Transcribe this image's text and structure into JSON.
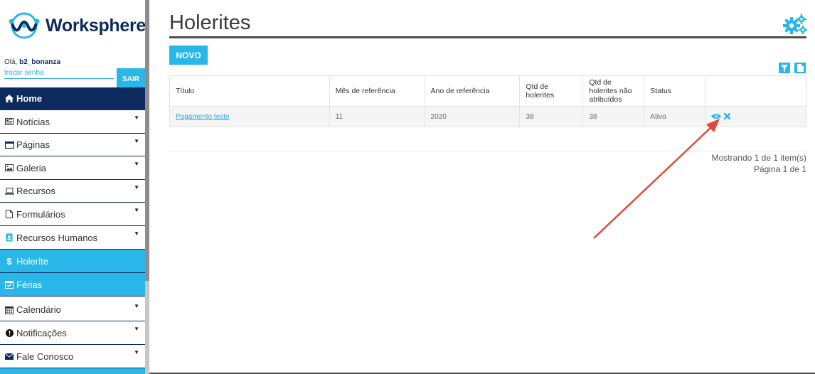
{
  "brand": {
    "name": "Worksphere"
  },
  "user": {
    "greeting": "Olá, ",
    "username": "b2_bonanza",
    "change_password": "trocar senha",
    "logout": "SAIR"
  },
  "sidebar": {
    "items": [
      {
        "label": "Home",
        "icon": "home-icon"
      },
      {
        "label": "Notícias",
        "icon": "newspaper-icon"
      },
      {
        "label": "Páginas",
        "icon": "window-icon"
      },
      {
        "label": "Galeria",
        "icon": "image-icon"
      },
      {
        "label": "Recursos",
        "icon": "laptop-icon"
      },
      {
        "label": "Formulários",
        "icon": "file-icon"
      },
      {
        "label": "Recursos Humanos",
        "icon": "id-badge-icon"
      },
      {
        "label": "Holerite",
        "icon": "dollar-icon"
      },
      {
        "label": "Férias",
        "icon": "calendar-check-icon"
      },
      {
        "label": "Calendário",
        "icon": "calendar-icon"
      },
      {
        "label": "Notificações",
        "icon": "exclamation-circle-icon"
      },
      {
        "label": "Fale Conosco",
        "icon": "envelope-icon"
      }
    ]
  },
  "page": {
    "title": "Holerites",
    "new_button": "NOVO"
  },
  "table": {
    "headers": [
      "Título",
      "Mês de referência",
      "Ano de referência",
      "Qtd de holerites",
      "Qtd de holerites não atribuídos",
      "Status",
      ""
    ],
    "rows": [
      {
        "titulo": "Pagamento teste",
        "mes": "11",
        "ano": "2020",
        "qtd": "38",
        "nao_atribuidos": "38",
        "status": "Ativo"
      }
    ]
  },
  "pager": {
    "showing": "Mostrando 1 de 1 item(s)",
    "page": "Página 1 de 1"
  },
  "colors": {
    "accent": "#29b6e8",
    "navy": "#0c2a5e",
    "arrow": "#e04a3a"
  }
}
